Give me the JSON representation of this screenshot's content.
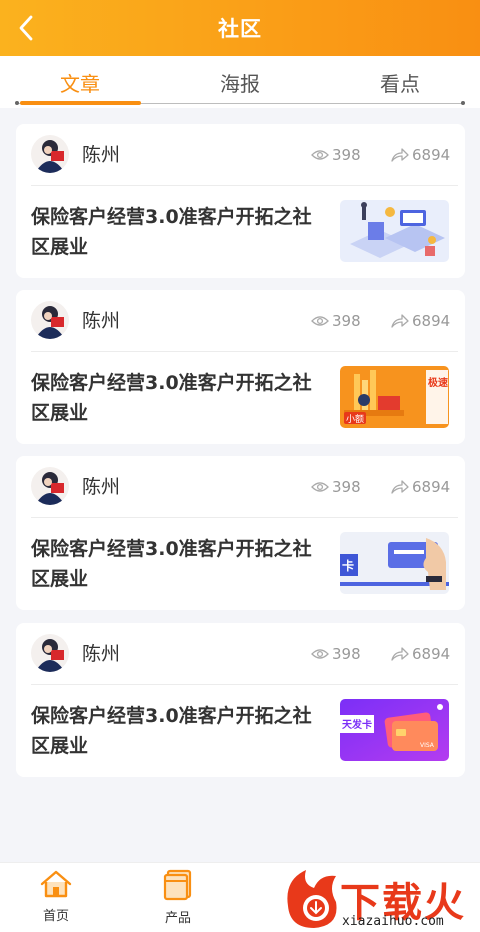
{
  "header": {
    "title": "社区"
  },
  "tabs": [
    {
      "label": "文章",
      "active": true
    },
    {
      "label": "海报",
      "active": false
    },
    {
      "label": "看点",
      "active": false
    }
  ],
  "posts": [
    {
      "author": "陈州",
      "views": "398",
      "shares": "6894",
      "title": "保险客户经营3.0准客户开拓之社区展业",
      "thumb": "isometric-illustration"
    },
    {
      "author": "陈州",
      "views": "398",
      "shares": "6894",
      "title": "保险客户经营3.0准客户开拓之社区展业",
      "thumb": "orange-promo-banner",
      "thumb_text": "小额"
    },
    {
      "author": "陈州",
      "views": "398",
      "shares": "6894",
      "title": "保险客户经营3.0准客户开拓之社区展业",
      "thumb": "card-in-hand-banner"
    },
    {
      "author": "陈州",
      "views": "398",
      "shares": "6894",
      "title": "保险客户经营3.0准客户开拓之社区展业",
      "thumb": "purple-card-banner",
      "thumb_text": "天发卡"
    }
  ],
  "bottom_nav": [
    {
      "label": "首页",
      "icon": "home-icon"
    },
    {
      "label": "产品",
      "icon": "product-icon"
    }
  ],
  "watermark": {
    "text": "下载火",
    "url": "xiazaihuo.com"
  },
  "colors": {
    "accent": "#f98f12",
    "header_start": "#fbb21e"
  }
}
